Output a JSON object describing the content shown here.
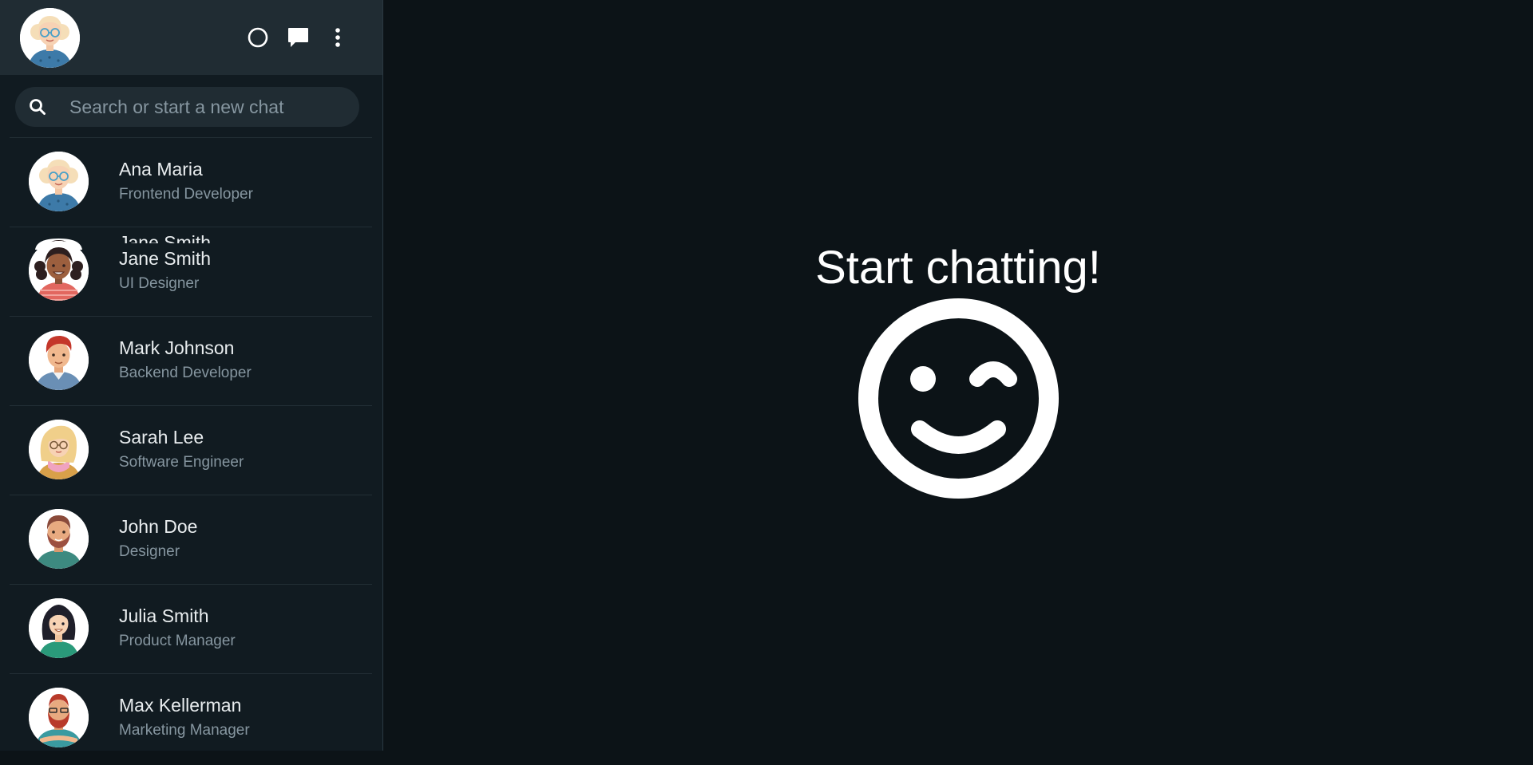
{
  "header": {
    "profile_avatar": "user-avatar-woman-glasses",
    "icons": [
      "status-icon",
      "new-chat-icon",
      "menu-icon"
    ]
  },
  "search": {
    "placeholder": "Search or start a new chat"
  },
  "chats": [
    {
      "name": "Ana Maria",
      "role": "Frontend Developer",
      "avatar": "avatar-woman-glasses"
    },
    {
      "name": "Jane Smith",
      "role": "UI Designer",
      "avatar": "avatar-woman-curly"
    },
    {
      "name": "Mark Johnson",
      "role": "Backend Developer",
      "avatar": "avatar-man-redhair"
    },
    {
      "name": "Sarah Lee",
      "role": "Software Engineer",
      "avatar": "avatar-woman-blonde-glasses"
    },
    {
      "name": "John Doe",
      "role": "Designer",
      "avatar": "avatar-man-beard"
    },
    {
      "name": "Julia Smith",
      "role": "Product Manager",
      "avatar": "avatar-woman-darkhair"
    },
    {
      "name": "Max Kellerman",
      "role": "Marketing Manager",
      "avatar": "avatar-man-redbeard"
    }
  ],
  "ghost_label": "Jane Smith",
  "main": {
    "title": "Start chatting!",
    "icon": "wink-smiley-icon"
  },
  "colors": {
    "sidebar_bg": "#111b21",
    "header_bg": "#202c33",
    "main_bg": "#0c1317",
    "text_primary": "#e9edef",
    "text_secondary": "#8696a0"
  }
}
